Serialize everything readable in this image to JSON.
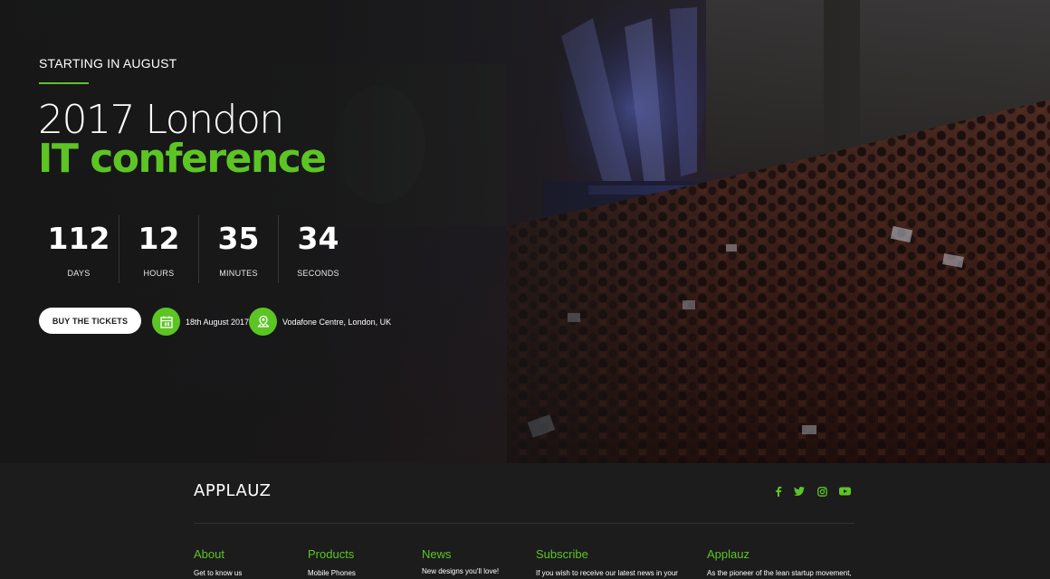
{
  "hero": {
    "eyebrow": "STARTING IN AUGUST",
    "title_line1": "2017 London",
    "title_line2": "IT conference",
    "countdown": [
      {
        "value": "112",
        "label": "DAYS"
      },
      {
        "value": "12",
        "label": "HOURS"
      },
      {
        "value": "35",
        "label": "MINUTES"
      },
      {
        "value": "34",
        "label": "SECONDS"
      }
    ],
    "buy_label": "BUY THE TICKETS",
    "date_text": "18th August 2017",
    "date_icon": "calendar-icon",
    "venue_text": "Vodafone Centre, London, UK",
    "venue_icon": "location-icon"
  },
  "footer": {
    "logo": "APPLAUZ",
    "social": [
      "facebook-icon",
      "twitter-icon",
      "instagram-icon",
      "youtube-icon"
    ],
    "columns": [
      {
        "heading": "About",
        "text": "Get to know us"
      },
      {
        "heading": "Products",
        "text": "Mobile Phones"
      },
      {
        "heading": "News",
        "text": "New designs you'll love!"
      },
      {
        "heading": "Subscribe",
        "text": "If you wish to receive our latest news in your"
      },
      {
        "heading": "Applauz",
        "text": "As the pioneer of the lean startup movement,"
      }
    ]
  },
  "colors": {
    "accent": "#5cc524",
    "background": "#1c1c1c",
    "button_bg": "#ffffff"
  }
}
